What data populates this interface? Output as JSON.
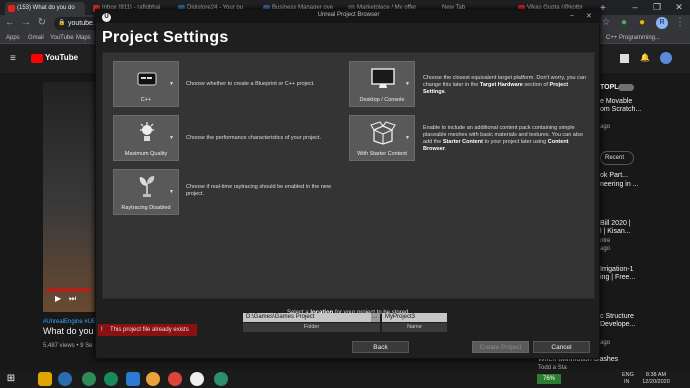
{
  "browser": {
    "tabs": [
      {
        "label": "(153) What do you do"
      },
      {
        "label": "Inbox (811) - rafiqbhai"
      },
      {
        "label": "Digistore24 - Your pu"
      },
      {
        "label": "Business Manager ove"
      },
      {
        "label": "Marketplace / My offer"
      },
      {
        "label": "New Tab"
      },
      {
        "label": "Vikas Gupta (@kotbr"
      }
    ],
    "new_tab": "+",
    "url": "youtube.com",
    "bookmarks": [
      "Apps",
      "Gmail",
      "YouTube",
      "Maps",
      "C++ Programming..."
    ]
  },
  "youtube": {
    "logo": "YouTube",
    "hashtags": "#UnrealEngine #UE4",
    "video_title": "What do you do",
    "views": "5,487 views • 9 Se",
    "autoplay": "TOPLAY",
    "recent": "Recent",
    "side": [
      "e Movable",
      "om Scratch...",
      "ago",
      "ok Part...",
      "neering in ...",
      "Bill 2020 |",
      "l | Kisan...",
      "ntre",
      "ago",
      "Irrigation-1",
      "ing | Free...",
      "c Structure",
      "Develope...",
      "ago"
    ],
    "recommend_title": "When twinmotion crashes",
    "recommend_sub": "Todd a Sta"
  },
  "dialog": {
    "window_title": "Unreal Project Browser",
    "heading": "Project Settings",
    "options": [
      {
        "caption": "C++",
        "description": "Choose whether to create a Blueprint or C++ project."
      },
      {
        "caption": "Maximum Quality",
        "description": "Choose the performance characteristics of your project."
      },
      {
        "caption": "Raytracing Disabled",
        "description": "Choose if real-time raytracing should be enabled in the new project."
      },
      {
        "caption": "Desktop / Console",
        "description_parts": [
          "Choose the closest equivalent target platform. Don't worry, you can change this later in the ",
          "Target Hardware",
          " section of ",
          "Project Settings",
          "."
        ]
      },
      {
        "caption": "With Starter Content",
        "description_parts": [
          "Enable to include an additional content pack containing simple placeable meshes with basic materials and textures. You can also add the ",
          "Starter Content",
          " to your project later using ",
          "Content Browser",
          "."
        ]
      }
    ],
    "location_prompt_parts": [
      "Select a ",
      "location",
      " for your project to be stored."
    ],
    "folder_value": "D:\\Games\\Games Project",
    "folder_label": "Folder",
    "folder_browse": "...",
    "name_value": "MyProject3",
    "name_label": "Name",
    "error": "This project file already exists",
    "back": "Back",
    "create": "Create Project",
    "cancel": "Cancel"
  },
  "taskbar": {
    "battery": "76%",
    "lang": "ENG",
    "region": "IN",
    "time": "8:38 AM",
    "date": "12/20/2020"
  }
}
